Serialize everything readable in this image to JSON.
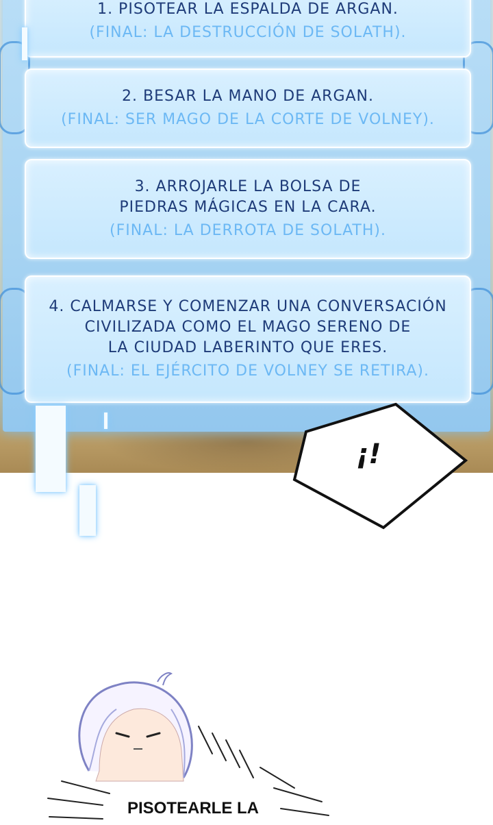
{
  "options": [
    {
      "lines": [
        "1. PISOTEAR LA ESPALDA DE ARGAN."
      ],
      "final": "(FINAL: LA DESTRUCCIÓN DE SOLATH)."
    },
    {
      "lines": [
        "2. BESAR LA MANO DE ARGAN."
      ],
      "final": "(FINAL: SER MAGO DE LA CORTE DE VOLNEY)."
    },
    {
      "lines": [
        "3. ARROJARLE LA BOLSA DE",
        "PIEDRAS MÁGICAS EN LA CARA."
      ],
      "final": "(FINAL: LA DERROTA DE SOLATH)."
    },
    {
      "lines": [
        "4. CALMARSE Y COMENZAR UNA CONVERSACIÓN",
        "CIVILIZADA COMO EL MAGO SERENO DE",
        "LA CIUDAD LABERINTO QUE ERES."
      ],
      "final": "(FINAL: EL EJÉRCITO DE VOLNEY SE RETIRA)."
    }
  ],
  "speech_bubble": {
    "text": "¡!"
  },
  "caption": {
    "text": "PISOTEARLE LA"
  }
}
